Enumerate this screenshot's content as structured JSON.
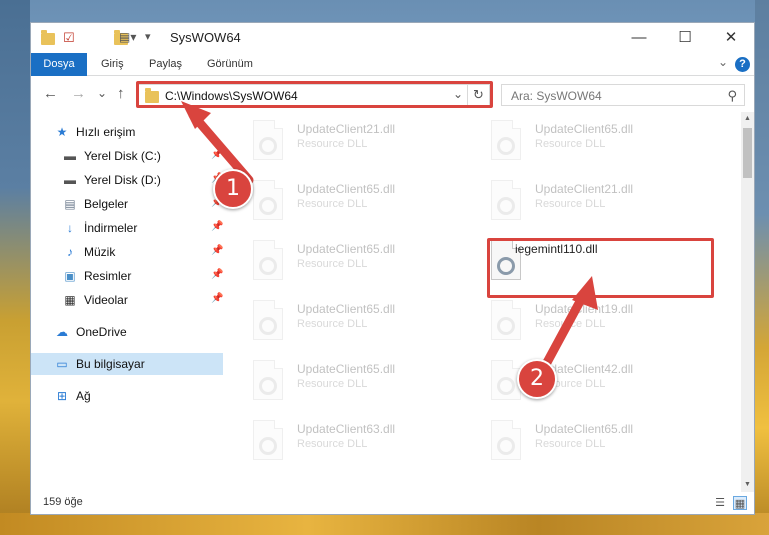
{
  "window": {
    "title": "SysWOW64"
  },
  "titlebar_buttons": {
    "minimize": "—",
    "maximize": "☐",
    "close": "✕"
  },
  "ribbon": {
    "tabs": [
      "Dosya",
      "Giriş",
      "Paylaş",
      "Görünüm"
    ],
    "help": "?"
  },
  "nav": {
    "back": "←",
    "forward": "→",
    "recent": "⌄",
    "up": "↑"
  },
  "address": {
    "path": "C:\\Windows\\SysWOW64"
  },
  "search": {
    "placeholder": "Ara: SysWOW64"
  },
  "sidebar": {
    "items": [
      {
        "label": "Hızlı erişim",
        "icon": "star-icon"
      },
      {
        "label": "Yerel Disk (C:)",
        "icon": "drive-icon"
      },
      {
        "label": "Yerel Disk (D:)",
        "icon": "drive-icon"
      },
      {
        "label": "Belgeler",
        "icon": "documents-icon"
      },
      {
        "label": "İndirmeler",
        "icon": "download-icon"
      },
      {
        "label": "Müzik",
        "icon": "music-icon"
      },
      {
        "label": "Resimler",
        "icon": "pictures-icon"
      },
      {
        "label": "Videolar",
        "icon": "video-icon"
      },
      {
        "label": "OneDrive",
        "icon": "cloud-icon"
      },
      {
        "label": "Bu bilgisayar",
        "icon": "computer-icon"
      },
      {
        "label": "Ağ",
        "icon": "network-icon"
      }
    ]
  },
  "files": [
    {
      "name": "UpdateClient21.dll",
      "desc": "Resource DLL"
    },
    {
      "name": "UpdateClient65.dll",
      "desc": "Resource DLL"
    },
    {
      "name": "UpdateClient65.dll",
      "desc": "Resource DLL"
    },
    {
      "name": "UpdateClient21.dll",
      "desc": "Resource DLL"
    },
    {
      "name": "UpdateClient65.dll",
      "desc": "Resource DLL"
    },
    {
      "name": "iegemintl110.dll",
      "desc": ""
    },
    {
      "name": "UpdateClient65.dll",
      "desc": "Resource DLL"
    },
    {
      "name": "UpdateClient19.dll",
      "desc": "Resource DLL"
    },
    {
      "name": "UpdateClient65.dll",
      "desc": "Resource DLL"
    },
    {
      "name": "UpdateClient42.dll",
      "desc": "Resource DLL"
    },
    {
      "name": "UpdateClient63.dll",
      "desc": "Resource DLL"
    },
    {
      "name": "UpdateClient65.dll",
      "desc": "Resource DLL"
    }
  ],
  "status": {
    "count": "159 öğe"
  },
  "steps": {
    "one": "1",
    "two": "2"
  },
  "colors": {
    "accent": "#1a6fc4",
    "highlight": "#d9443e",
    "selected": "#cce4f7"
  }
}
